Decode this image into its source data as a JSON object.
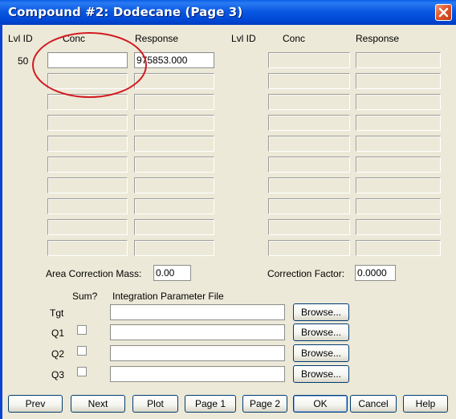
{
  "window": {
    "title": "Compound #2: Dodecane (Page 3)"
  },
  "left_table": {
    "col_lvlid": "Lvl ID",
    "col_conc": "Conc",
    "col_response": "Response",
    "rows": [
      {
        "lvl": "50",
        "conc": "",
        "response": "975853.000"
      },
      {
        "lvl": "",
        "conc": "",
        "response": ""
      },
      {
        "lvl": "",
        "conc": "",
        "response": ""
      },
      {
        "lvl": "",
        "conc": "",
        "response": ""
      },
      {
        "lvl": "",
        "conc": "",
        "response": ""
      },
      {
        "lvl": "",
        "conc": "",
        "response": ""
      },
      {
        "lvl": "",
        "conc": "",
        "response": ""
      },
      {
        "lvl": "",
        "conc": "",
        "response": ""
      },
      {
        "lvl": "",
        "conc": "",
        "response": ""
      },
      {
        "lvl": "",
        "conc": "",
        "response": ""
      }
    ]
  },
  "right_table": {
    "col_lvlid": "Lvl ID",
    "col_conc": "Conc",
    "col_response": "Response"
  },
  "area_correction": {
    "label": "Area Correction Mass:",
    "value": "0.00"
  },
  "correction_factor": {
    "label": "Correction Factor:",
    "value": "0.0000"
  },
  "integration": {
    "col_sum": "Sum?",
    "col_file": "Integration Parameter File",
    "browse_label": "Browse...",
    "rows": [
      {
        "name": "Tgt",
        "checked": false,
        "file": ""
      },
      {
        "name": "Q1",
        "checked": false,
        "file": ""
      },
      {
        "name": "Q2",
        "checked": false,
        "file": ""
      },
      {
        "name": "Q3",
        "checked": false,
        "file": ""
      }
    ]
  },
  "buttons": {
    "prev": "Prev",
    "next": "Next",
    "plot": "Plot",
    "page1": "Page 1",
    "page2": "Page 2",
    "ok": "OK",
    "cancel": "Cancel",
    "help": "Help"
  },
  "annotation": {
    "color": "#d3181f"
  }
}
